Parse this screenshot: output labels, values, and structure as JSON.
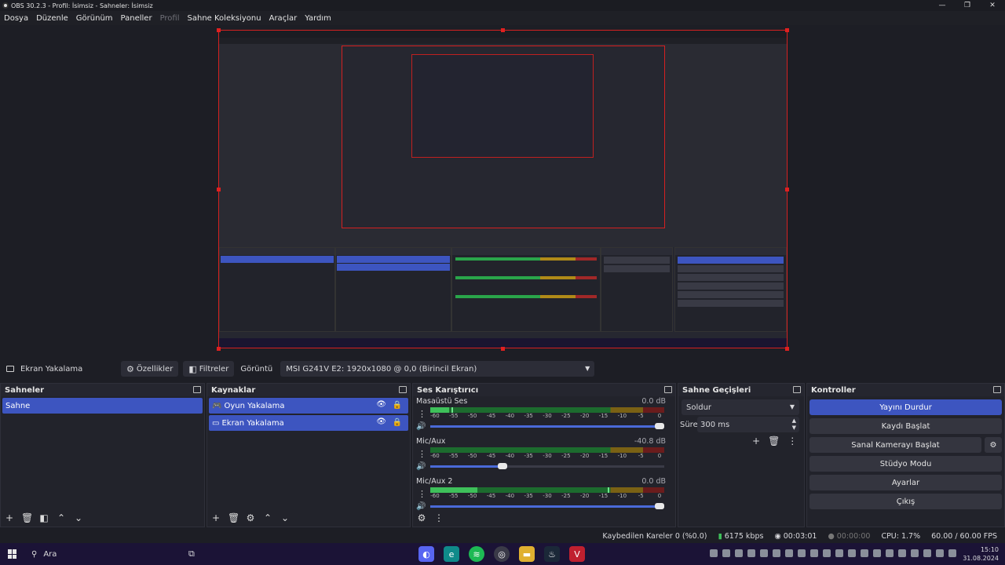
{
  "window": {
    "title": "OBS 30.2.3 - Profil: İsimsiz - Sahneler: İsimsiz",
    "controls": [
      "—",
      "❐",
      "✕"
    ]
  },
  "menu": [
    "Dosya",
    "Düzenle",
    "Görünüm",
    "Paneller",
    "Profil",
    "Sahne Koleksiyonu",
    "Araçlar",
    "Yardım"
  ],
  "preview": {
    "border_color": "#d42020"
  },
  "source_bar": {
    "source_name": "Ekran Yakalama",
    "properties_label": "Özellikler",
    "filters_label": "Filtreler",
    "display_label": "Görüntü",
    "display_value": "MSI G241V E2: 1920x1080 @ 0,0 (Birincil Ekran)"
  },
  "scenes": {
    "title": "Sahneler",
    "items": [
      "Sahne"
    ]
  },
  "sources": {
    "title": "Kaynaklar",
    "items": [
      {
        "label": "Oyun Yakalama",
        "icon": "gamepad-icon"
      },
      {
        "label": "Ekran Yakalama",
        "icon": "monitor-icon"
      }
    ]
  },
  "mixer": {
    "title": "Ses Karıştırıcı",
    "ticks": [
      "-60",
      "-55",
      "-50",
      "-45",
      "-40",
      "-35",
      "-30",
      "-25",
      "-20",
      "-15",
      "-10",
      "-5",
      "0"
    ],
    "channels": [
      {
        "name": "Masaüstü Ses",
        "db": "0.0 dB",
        "level": 0.08,
        "peak": 0.09,
        "volume": 1.0
      },
      {
        "name": "Mic/Aux",
        "db": "-40.8 dB",
        "level": 0.0,
        "peak": 0.0,
        "volume": 0.33
      },
      {
        "name": "Mic/Aux 2",
        "db": "0.0 dB",
        "level": 0.2,
        "peak": 0.76,
        "volume": 1.0
      }
    ]
  },
  "transitions": {
    "title": "Sahne Geçişleri",
    "selected": "Soldur",
    "duration_label": "Süre",
    "duration_value": "300 ms"
  },
  "controls": {
    "title": "Kontroller",
    "buttons": [
      "Yayını Durdur",
      "Kaydı Başlat",
      "Sanal Kamerayı Başlat",
      "Stüdyo Modu",
      "Ayarlar",
      "Çıkış"
    ]
  },
  "status": {
    "dropped": "Kaybedilen Kareler 0 (%0.0)",
    "bitrate": "6175 kbps",
    "stream_time": "00:03:01",
    "rec_time": "00:00:00",
    "cpu": "CPU: 1.7%",
    "fps": "60.00 / 60.00 FPS"
  },
  "taskbar": {
    "search_placeholder": "Ara",
    "time": "15:10",
    "date": "31.08.2024"
  }
}
